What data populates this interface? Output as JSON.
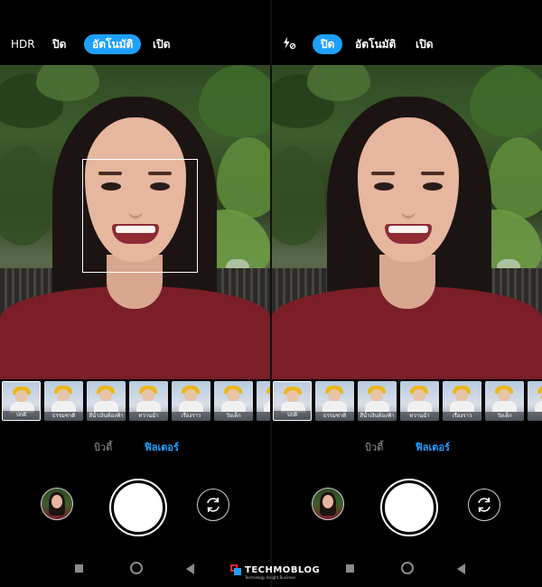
{
  "left": {
    "topbar": {
      "hdr_label": "HDR",
      "options": [
        "ปิด",
        "อัตโนมัติ",
        "เปิด"
      ],
      "selected": "อัตโนมัติ"
    },
    "filters": [
      "ปกติ",
      "ธรรมชาติ",
      "สีน้ำเงินท้องฟ้า",
      "หวานฉ่ำ",
      "เรื่องราว",
      "วัยเด็ก",
      "เซ"
    ],
    "selected_filter": "ปกติ",
    "mode_tabs": [
      "บิวตี้",
      "ฟิลเตอร์"
    ],
    "active_mode": "ฟิลเตอร์"
  },
  "right": {
    "topbar": {
      "flash_icon": "flash-off-icon",
      "options": [
        "ปิด",
        "อัตโนมัติ",
        "เปิด"
      ],
      "selected": "ปิด"
    },
    "filters": [
      "ปกติ",
      "ธรรมชาติ",
      "สีน้ำเงินท้องฟ้า",
      "หวานฉ่ำ",
      "เรื่องราว",
      "วัยเด็ก",
      "เซ"
    ],
    "selected_filter": "ปกติ",
    "mode_tabs": [
      "บิวตี้",
      "ฟิลเตอร์"
    ],
    "active_mode": "ฟิลเตอร์"
  },
  "watermark": {
    "text": "TECHMOBLOG",
    "tagline": "Technology Insight Business"
  },
  "colors": {
    "accent": "#1ea0ff",
    "background": "#000000",
    "shirt": "#7a1e28"
  }
}
